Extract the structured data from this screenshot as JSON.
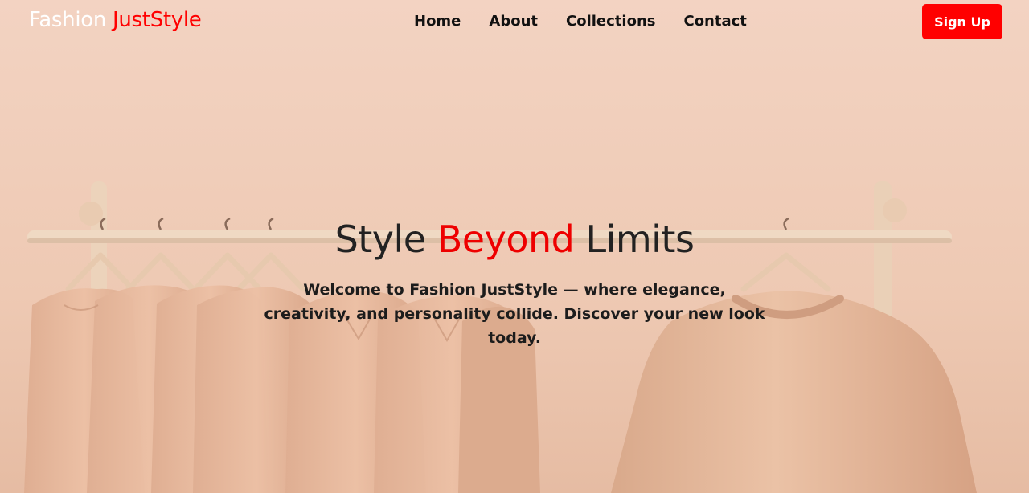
{
  "brand": {
    "part1": "Fashion",
    "part2": "JustStyle"
  },
  "nav": [
    {
      "label": "Home"
    },
    {
      "label": "About"
    },
    {
      "label": "Collections"
    },
    {
      "label": "Contact"
    }
  ],
  "signup_label": "Sign Up",
  "hero": {
    "title_part1": "Style",
    "title_accent": "Beyond",
    "title_part2": "Limits",
    "subtitle": "Welcome to Fashion JustStyle — where elegance, creativity, and personality collide. Discover your new look today."
  },
  "colors": {
    "accent": "#ff0000",
    "background": "#f0cdb8",
    "garment": "#e8b99c",
    "rack": "#ecd2b8"
  }
}
